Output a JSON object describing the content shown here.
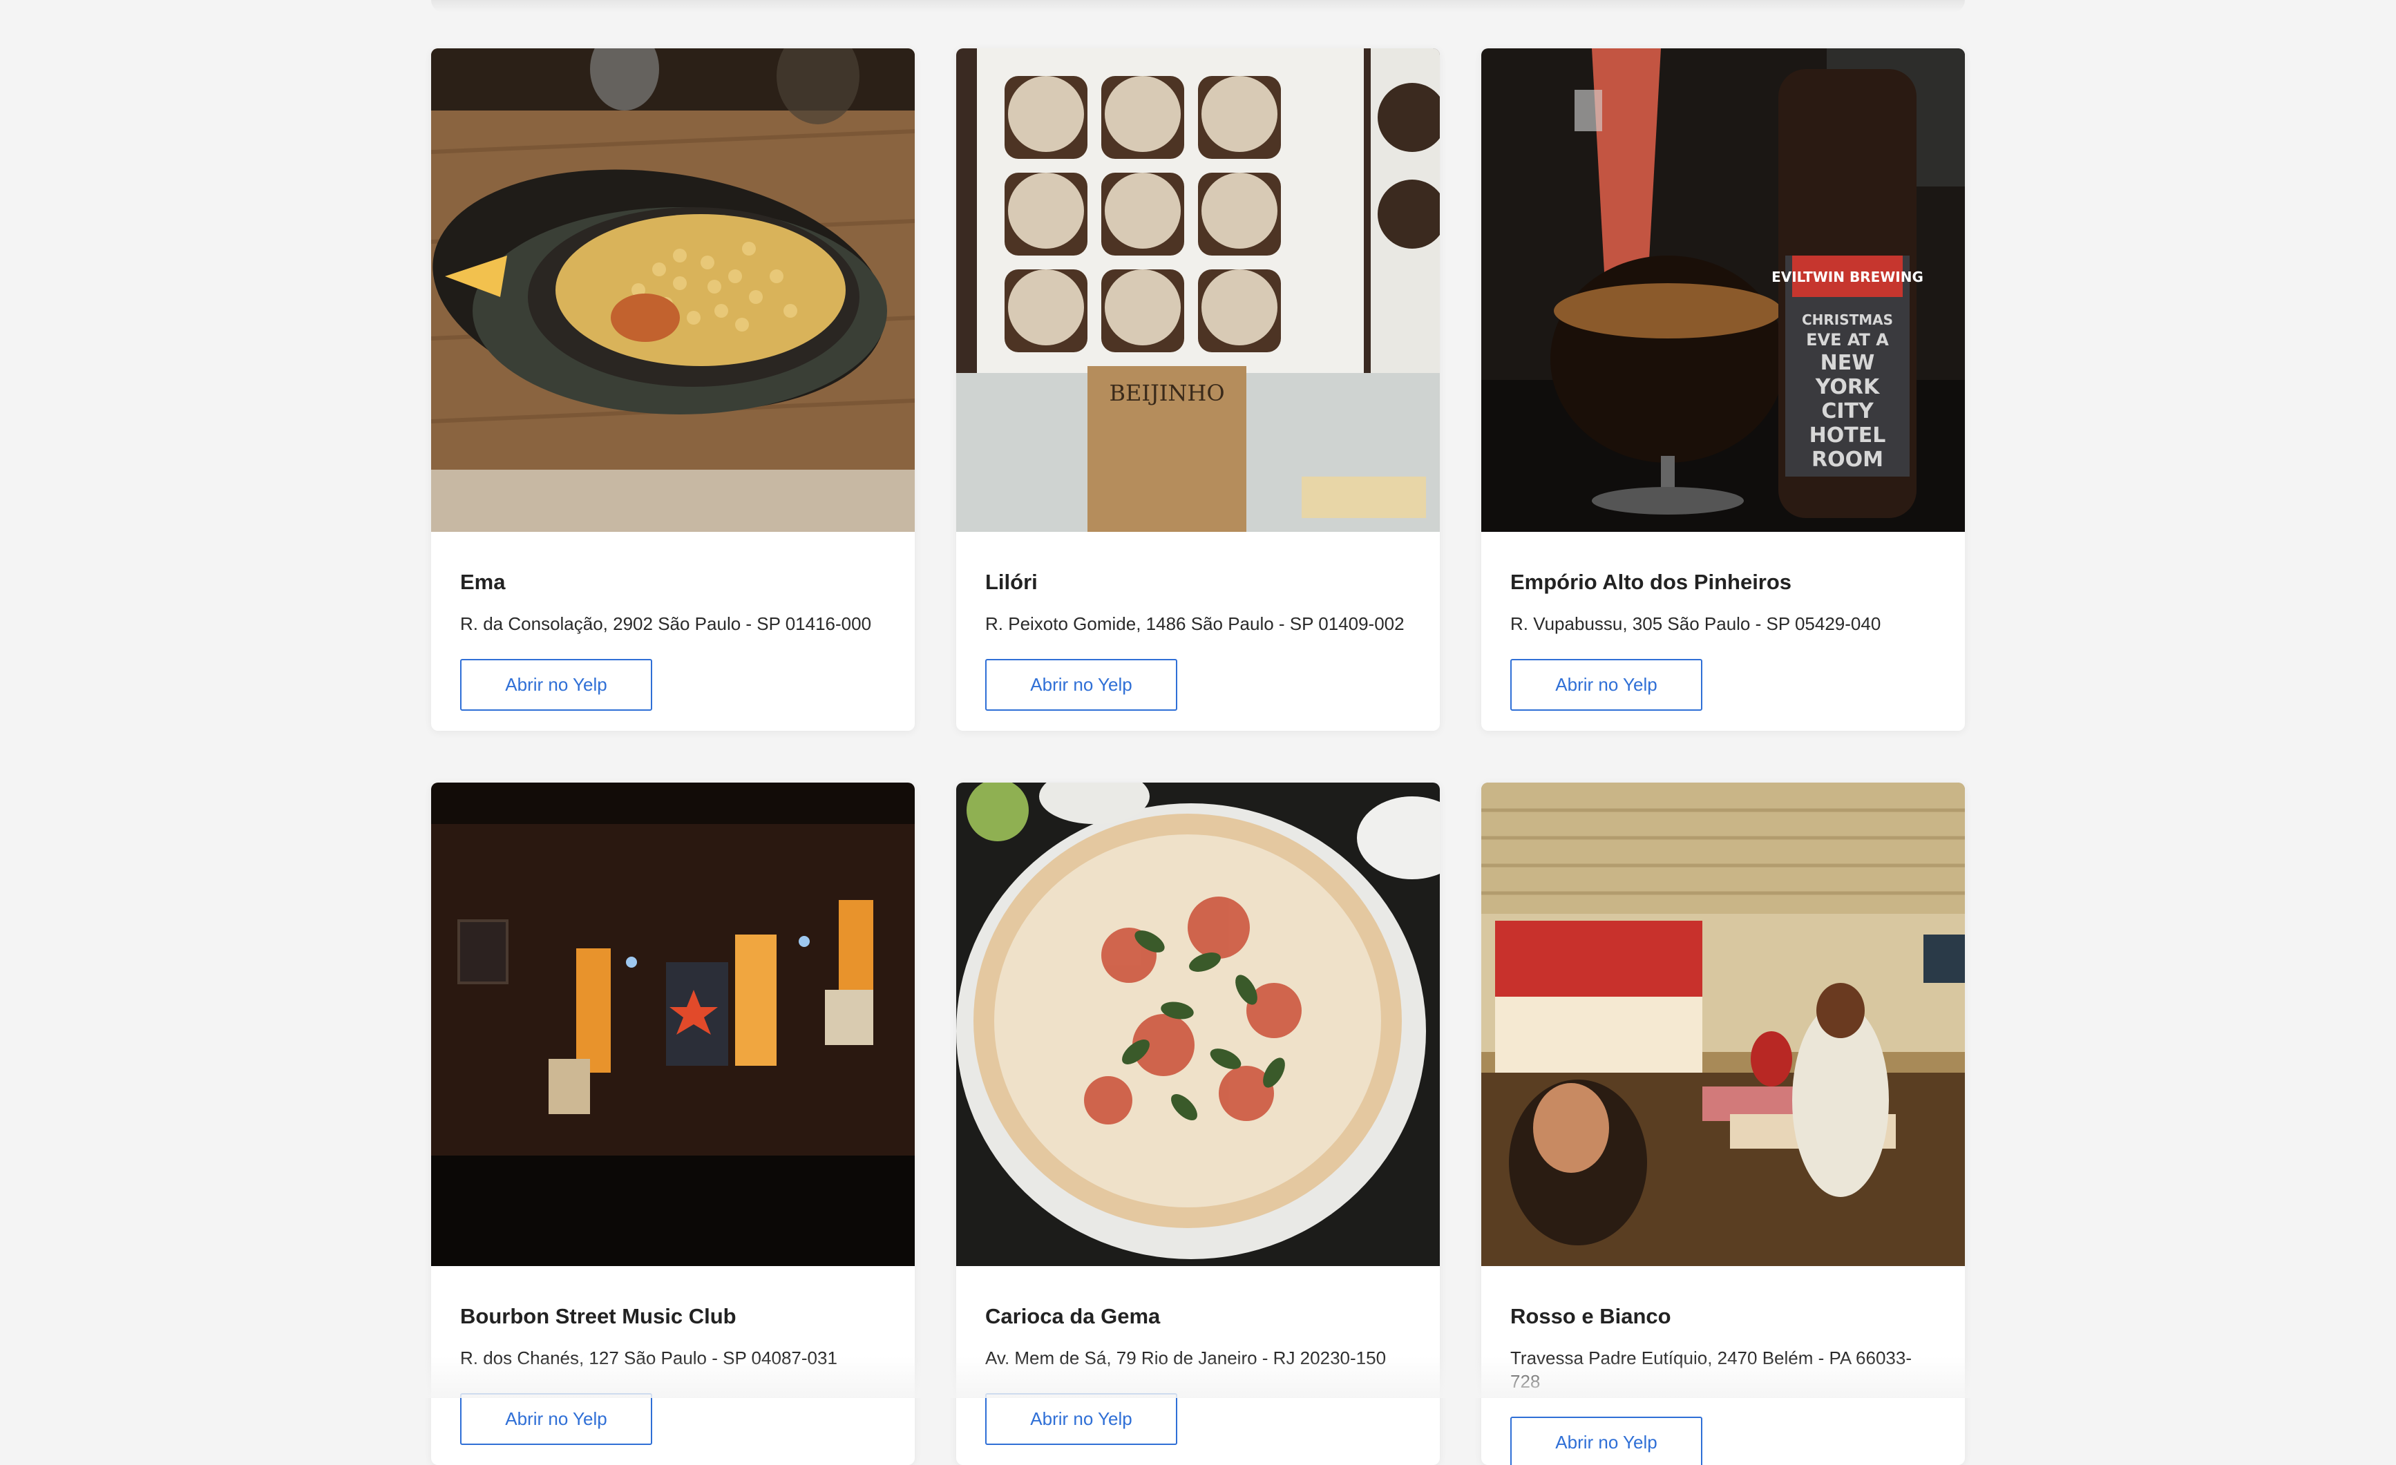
{
  "button_label": "Abrir no Yelp",
  "restaurants": [
    {
      "name": "Ema",
      "address": "R. da Consolação, 2902 São Paulo - SP 01416-000",
      "photo": "ema-photo"
    },
    {
      "name": "Lilóri",
      "address": "R. Peixoto Gomide, 1486 São Paulo - SP 01409-002",
      "photo": "lilori-photo"
    },
    {
      "name": "Empório Alto dos Pinheiros",
      "address": "R. Vupabussu, 305 São Paulo - SP 05429-040",
      "photo": "emporio-photo"
    },
    {
      "name": "Bourbon Street Music Club",
      "address": "R. dos Chanés, 127 São Paulo - SP 04087-031",
      "photo": "bourbon-photo"
    },
    {
      "name": "Carioca da Gema",
      "address": "Av. Mem de Sá, 79 Rio de Janeiro - RJ 20230-150",
      "photo": "carioca-photo"
    },
    {
      "name": "Rosso e Bianco",
      "address": "Travessa Padre Eutíquio, 2470 Belém - PA 66033-728",
      "photo": "rosso-photo"
    }
  ],
  "photo_text": {
    "beijinho_label": "BEIJINHO",
    "beer_brand": "EVILTWIN BREWING",
    "beer_line1": "CHRISTMAS",
    "beer_line2": "EVE AT A",
    "beer_line3": "NEW",
    "beer_line4": "YORK",
    "beer_line5": "CITY",
    "beer_line6": "HOTEL",
    "beer_line7": "ROOM"
  }
}
